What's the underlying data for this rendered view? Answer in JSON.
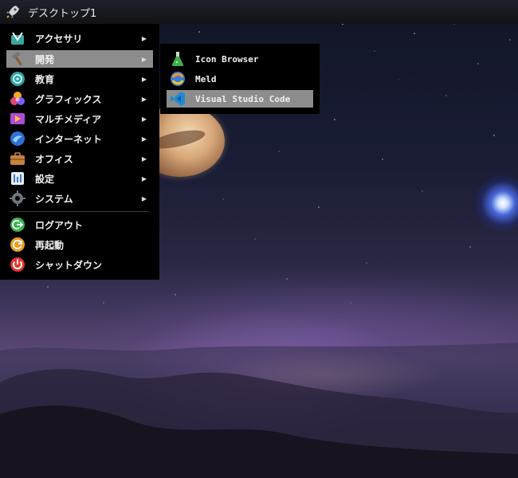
{
  "panel": {
    "workspace_title": "デスクトップ1",
    "launcher_icon": "rocket-icon"
  },
  "menu": {
    "items": [
      {
        "label": "アクセサリ",
        "icon": "accessories-icon",
        "has_submenu": true
      },
      {
        "label": "開発",
        "icon": "development-hammer-icon",
        "has_submenu": true,
        "active": true
      },
      {
        "label": "教育",
        "icon": "education-icon",
        "has_submenu": true
      },
      {
        "label": "グラフィックス",
        "icon": "graphics-icon",
        "has_submenu": true
      },
      {
        "label": "マルチメディア",
        "icon": "multimedia-icon",
        "has_submenu": true
      },
      {
        "label": "インターネット",
        "icon": "internet-globe-icon",
        "has_submenu": true
      },
      {
        "label": "オフィス",
        "icon": "office-briefcase-icon",
        "has_submenu": true
      },
      {
        "label": "設定",
        "icon": "settings-icon",
        "has_submenu": true
      },
      {
        "label": "システム",
        "icon": "system-gear-icon",
        "has_submenu": true
      }
    ],
    "session": [
      {
        "label": "ログアウト",
        "icon": "logout-icon"
      },
      {
        "label": "再起動",
        "icon": "restart-icon"
      },
      {
        "label": "シャットダウン",
        "icon": "shutdown-icon"
      }
    ],
    "submenu_arrow": "▶"
  },
  "submenu": {
    "items": [
      {
        "label": "Icon Browser",
        "icon": "flask-icon"
      },
      {
        "label": "Meld",
        "icon": "meld-icon"
      },
      {
        "label": "Visual Studio Code",
        "icon": "vscode-icon",
        "active": true
      }
    ]
  },
  "colors": {
    "menu_bg": "#000000",
    "highlight": "#8c8c8c",
    "text": "#f0f0f0"
  }
}
